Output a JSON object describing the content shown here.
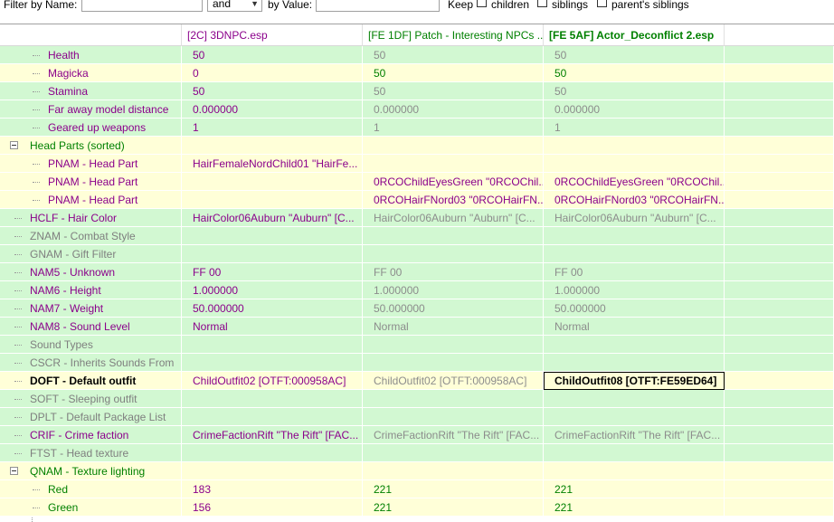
{
  "filter": {
    "name_label": "Filter by Name:",
    "name_value": "",
    "operator": "and",
    "value_label": "by Value:",
    "value_value": "",
    "keep_label": "Keep",
    "children_label": "children",
    "siblings_label": "siblings",
    "parent_siblings_label": "parent's siblings"
  },
  "columns": [
    "",
    "[2C] 3DNPC.esp",
    "[FE 1DF] Patch - Interesting NPCs ...",
    "[FE 5AF] Actor_Deconflict 2.esp"
  ],
  "rows": [
    {
      "label": "Health",
      "values": [
        "50",
        "50",
        "50"
      ]
    },
    {
      "label": "Magicka",
      "values": [
        "0",
        "50",
        "50"
      ]
    },
    {
      "label": "Stamina",
      "values": [
        "50",
        "50",
        "50"
      ]
    },
    {
      "label": "Far away model distance",
      "values": [
        "0.000000",
        "0.000000",
        "0.000000"
      ]
    },
    {
      "label": "Geared up weapons",
      "values": [
        "1",
        "1",
        "1"
      ]
    },
    {
      "label": "Head Parts (sorted)",
      "values": [
        "",
        "",
        ""
      ]
    },
    {
      "label": "PNAM - Head Part",
      "values": [
        "HairFemaleNordChild01 \"HairFe...",
        "",
        ""
      ]
    },
    {
      "label": "PNAM - Head Part",
      "values": [
        "",
        "0RCOChildEyesGreen \"0RCOChil...",
        "0RCOChildEyesGreen \"0RCOChil..."
      ]
    },
    {
      "label": "PNAM - Head Part",
      "values": [
        "",
        "0RCOHairFNord03 \"0RCOHairFN...",
        "0RCOHairFNord03 \"0RCOHairFN..."
      ]
    },
    {
      "label": "HCLF - Hair Color",
      "values": [
        "HairColor06Auburn \"Auburn\" [C...",
        "HairColor06Auburn \"Auburn\" [C...",
        "HairColor06Auburn \"Auburn\" [C..."
      ]
    },
    {
      "label": "ZNAM - Combat Style",
      "values": [
        "",
        "",
        ""
      ]
    },
    {
      "label": "GNAM - Gift Filter",
      "values": [
        "",
        "",
        ""
      ]
    },
    {
      "label": "NAM5 - Unknown",
      "values": [
        "FF 00",
        "FF 00",
        "FF 00"
      ]
    },
    {
      "label": "NAM6 - Height",
      "values": [
        "1.000000",
        "1.000000",
        "1.000000"
      ]
    },
    {
      "label": "NAM7 - Weight",
      "values": [
        "50.000000",
        "50.000000",
        "50.000000"
      ]
    },
    {
      "label": "NAM8 - Sound Level",
      "values": [
        "Normal",
        "Normal",
        "Normal"
      ]
    },
    {
      "label": "Sound Types",
      "values": [
        "",
        "",
        ""
      ]
    },
    {
      "label": "CSCR - Inherits Sounds From",
      "values": [
        "",
        "",
        ""
      ]
    },
    {
      "label": "DOFT - Default outfit",
      "values": [
        "ChildOutfit02 [OTFT:000958AC]",
        "ChildOutfit02 [OTFT:000958AC]",
        "ChildOutfit08 [OTFT:FE59ED64]"
      ]
    },
    {
      "label": "SOFT - Sleeping outfit",
      "values": [
        "",
        "",
        ""
      ]
    },
    {
      "label": "DPLT - Default Package List",
      "values": [
        "",
        "",
        ""
      ]
    },
    {
      "label": "CRIF - Crime faction",
      "values": [
        "CrimeFactionRift \"The Rift\" [FAC...",
        "CrimeFactionRift \"The Rift\" [FAC...",
        "CrimeFactionRift \"The Rift\" [FAC..."
      ]
    },
    {
      "label": "FTST - Head texture",
      "values": [
        "",
        "",
        ""
      ]
    },
    {
      "label": "QNAM - Texture lighting",
      "values": [
        "",
        "",
        ""
      ]
    },
    {
      "label": "Red",
      "values": [
        "183",
        "221",
        "221"
      ]
    },
    {
      "label": "Green",
      "values": [
        "156",
        "221",
        "221"
      ]
    }
  ],
  "colors": {
    "green_row": "#d2f8d2",
    "yellow_row": "#ffffd8",
    "label_green": "#008000",
    "label_purple": "#8b008b",
    "disabled_gray": "#7f7f7f"
  }
}
